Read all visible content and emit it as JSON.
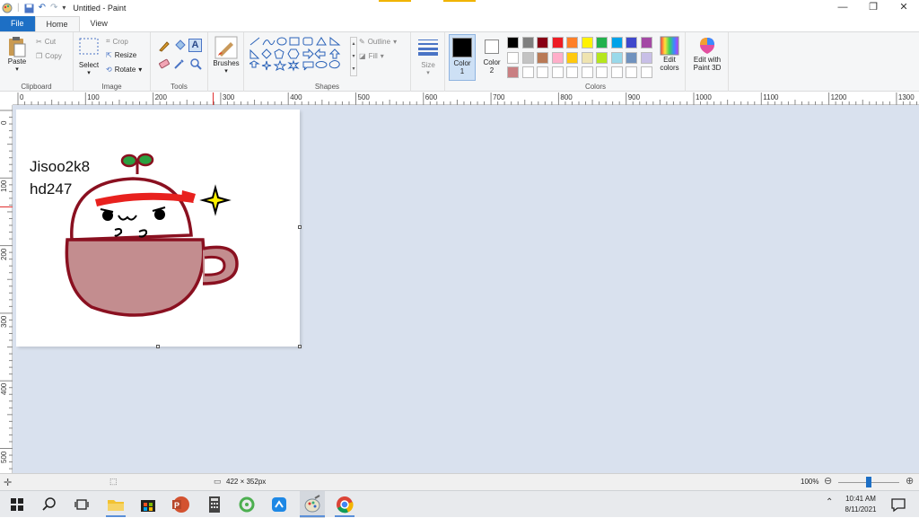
{
  "window": {
    "title": "Untitled - Paint"
  },
  "tabs": [
    {
      "label": "File"
    },
    {
      "label": "Home"
    },
    {
      "label": "View"
    }
  ],
  "ribbon": {
    "clipboard": {
      "label": "Clipboard",
      "paste": "Paste",
      "cut": "Cut",
      "copy": "Copy"
    },
    "image": {
      "label": "Image",
      "select": "Select",
      "crop": "Crop",
      "resize": "Resize",
      "rotate": "Rotate"
    },
    "tools": {
      "label": "Tools"
    },
    "brushes": {
      "label": "Brushes"
    },
    "shapes": {
      "label": "Shapes",
      "outline": "Outline",
      "fill": "Fill"
    },
    "size": {
      "label": "Size"
    },
    "color1": {
      "label": "Color",
      "sub": "1"
    },
    "color2": {
      "label": "Color",
      "sub": "2"
    },
    "colors": {
      "label": "Colors",
      "row1": [
        "#000000",
        "#7f7f7f",
        "#880015",
        "#ed1c24",
        "#ff7f27",
        "#fff200",
        "#22b14c",
        "#00a2e8",
        "#3f48cc",
        "#a349a4"
      ],
      "row2": [
        "#ffffff",
        "#c3c3c3",
        "#b97a57",
        "#ffaec9",
        "#ffc90e",
        "#efe4b0",
        "#b5e61d",
        "#99d9ea",
        "#7092be",
        "#c8bfe7"
      ],
      "row3": [
        "#c97f82",
        "#ffffff",
        "#ffffff",
        "#ffffff",
        "#ffffff",
        "#ffffff",
        "#ffffff",
        "#ffffff",
        "#ffffff",
        "#ffffff"
      ]
    },
    "edit_colors": {
      "line1": "Edit",
      "line2": "colors"
    },
    "paint3d": {
      "line1": "Edit with",
      "line2": "Paint 3D"
    }
  },
  "ruler_h": [
    "0",
    "100",
    "200",
    "300",
    "400",
    "500",
    "600",
    "700",
    "800",
    "900",
    "1000",
    "1100",
    "1200",
    "1300"
  ],
  "ruler_v": [
    "0",
    "100",
    "200",
    "300",
    "400",
    "500"
  ],
  "canvas_text": {
    "line1": "Jisoo2k8",
    "line2": "hd247"
  },
  "status": {
    "dimensions": "422 × 352px",
    "zoom": "100%"
  },
  "taskbar": {
    "time": "10:41 AM",
    "date": "8/11/2021"
  }
}
